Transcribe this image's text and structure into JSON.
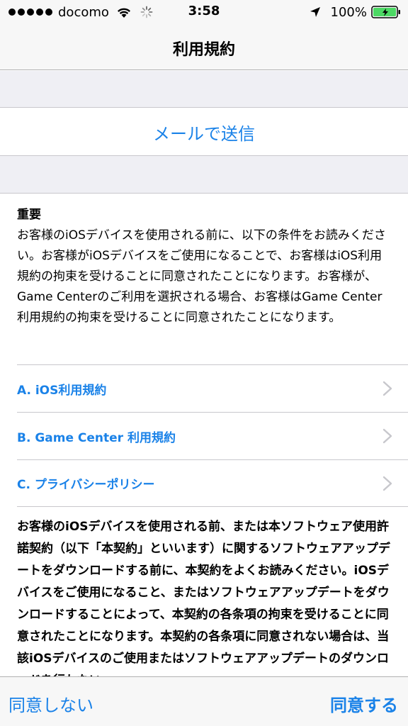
{
  "status_bar": {
    "carrier": "docomo",
    "time": "3:58",
    "battery_percent": "100%",
    "signal_bars": 5,
    "icons": [
      "signal-dots",
      "wifi-icon",
      "activity-spinner-icon",
      "location-arrow-icon",
      "battery-icon"
    ]
  },
  "nav": {
    "title": "利用規約"
  },
  "mail_action": {
    "label": "メールで送信"
  },
  "content": {
    "important_heading": "重要",
    "intro": "お客様のiOSデバイスを使用される前に、以下の条件をお読みください。お客様がiOSデバイスをご使用になることで、お客様はiOS利用規約の拘束を受けることに同意されたことになります。お客様が、Game Centerのご利用を選択される場合、お客様はGame Center利用規約の拘束を受けることに同意されたことになります。",
    "links": [
      {
        "label": "A. iOS利用規約"
      },
      {
        "label": "B. Game Center 利用規約"
      },
      {
        "label": "C. プライバシーポリシー"
      }
    ],
    "agreement": "お客様のiOSデバイスを使用される前、または本ソフトウェア使用許諾契約（以下「本契約」といいます）に関するソフトウェアアップデートをダウンロードする前に、本契約をよくお読みください。iOSデバイスをご使用になること、またはソフトウェアアップデートをダウンロードすることによって、本契約の各条項の拘束を受けることに同意されたことになります。本契約の各条項に同意されない場合は、当該iOSデバイスのご使用またはソフトウェアアップデートのダウンロードを行わない"
  },
  "bottom_bar": {
    "disagree_label": "同意しない",
    "agree_label": "同意する"
  },
  "colors": {
    "accent": "#1a82e8",
    "bar_background": "#f7f7f7",
    "group_background": "#efeff4",
    "separator": "#c8c7cc",
    "battery": "#4cd964"
  }
}
